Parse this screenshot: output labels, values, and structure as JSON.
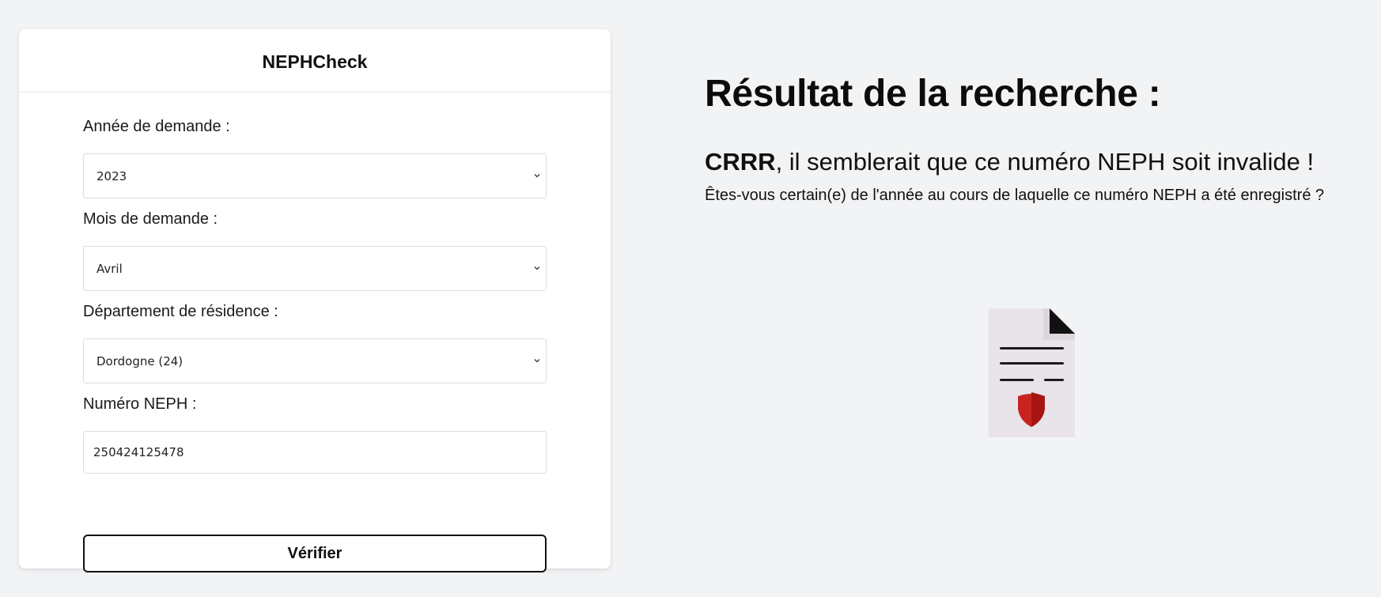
{
  "app": {
    "title": "NEPHCheck"
  },
  "form": {
    "year": {
      "label": "Année de demande :",
      "value": "2023"
    },
    "month": {
      "label": "Mois de demande :",
      "value": "Avril"
    },
    "department": {
      "label": "Département de résidence :",
      "value": "Dordogne (24)"
    },
    "neph": {
      "label": "Numéro NEPH :",
      "value": "250424125478"
    },
    "submit_label": "Vérifier"
  },
  "result": {
    "title": "Résultat de la recherche :",
    "name": "CRRR",
    "message": ", il semblerait que ce numéro NEPH soit invalide !",
    "detail": "Êtes-vous certain(e) de l'année au cours de laquelle ce numéro NEPH a été enregistré ?"
  },
  "icons": {
    "select_arrow": "chevron-down-icon",
    "illustration": "invalid-document-shield-icon"
  },
  "colors": {
    "page_background": "#f2f3f5",
    "card_background": "#ffffff",
    "document_fill": "#e9e4ea",
    "shield_red": "#c8241f",
    "shield_dark": "#a51512"
  }
}
